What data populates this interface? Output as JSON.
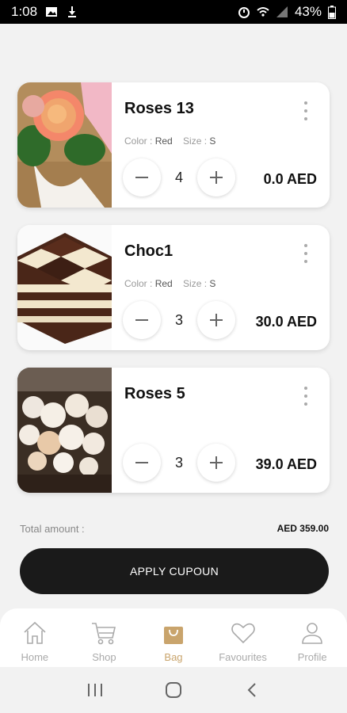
{
  "status_bar": {
    "time": "1:08",
    "battery": "43%"
  },
  "cart": {
    "items": [
      {
        "name": "Roses 13",
        "color_label": "Color :",
        "color_value": "Red",
        "size_label": "Size :",
        "size_value": "S",
        "quantity": "4",
        "price": "0.0 AED",
        "image": "roses-bouquet-image"
      },
      {
        "name": "Choc1",
        "color_label": "Color :",
        "color_value": "Red",
        "size_label": "Size :",
        "size_value": "S",
        "quantity": "3",
        "price": "30.0 AED",
        "image": "chocolate-stack-image"
      },
      {
        "name": "Roses 5",
        "quantity": "3",
        "price": "39.0 AED",
        "image": "white-flowers-box-image"
      }
    ],
    "total_label": "Total amount :",
    "total_value": "AED 359.00",
    "apply_label": "APPLY CUPOUN"
  },
  "bottom_nav": {
    "items": [
      {
        "label": "Home",
        "icon": "home-icon"
      },
      {
        "label": "Shop",
        "icon": "cart-icon"
      },
      {
        "label": "Bag",
        "icon": "bag-icon"
      },
      {
        "label": "Favourites",
        "icon": "heart-icon"
      },
      {
        "label": "Profile",
        "icon": "profile-icon"
      }
    ],
    "active": "Bag"
  },
  "colors": {
    "accent": "#c9a46c",
    "button_bg": "#1a1a1a"
  }
}
